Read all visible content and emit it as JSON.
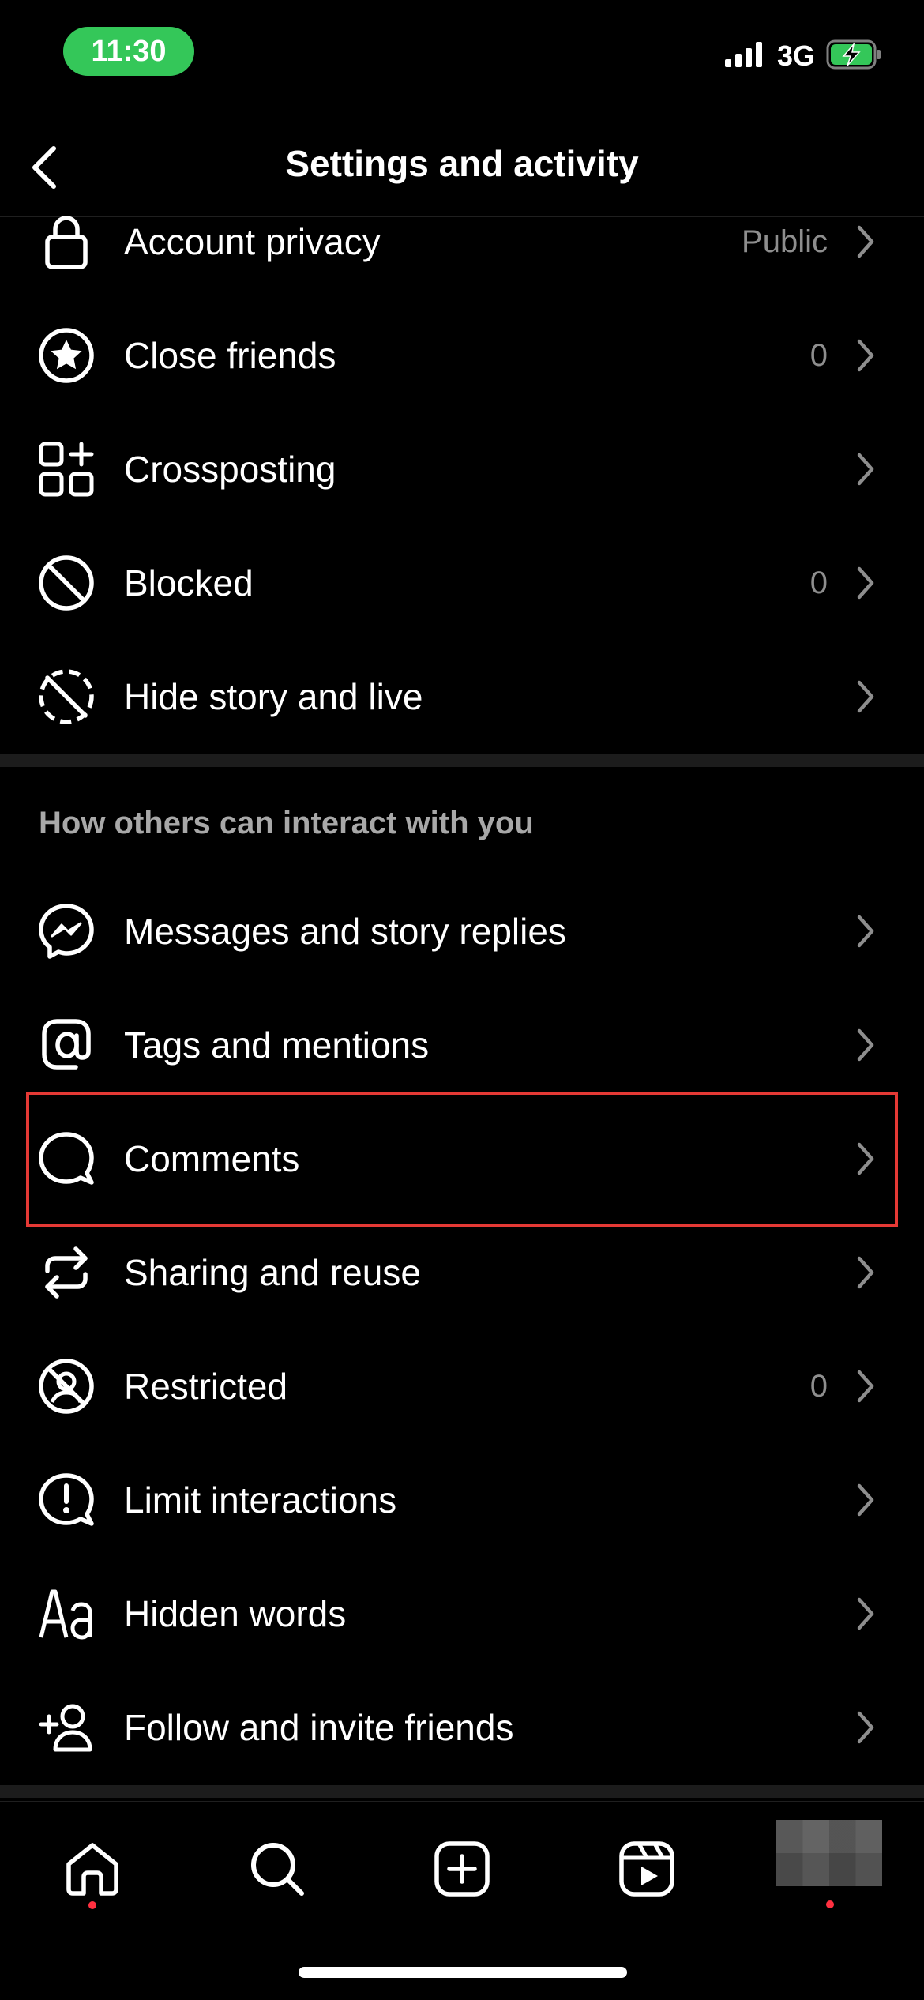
{
  "status_bar": {
    "time": "11:30",
    "network": "3G",
    "battery_icon": "battery-charging-icon",
    "signal_icon": "signal-bars-icon"
  },
  "header": {
    "title": "Settings and activity",
    "back_icon": "chevron-left-icon"
  },
  "privacy_section": {
    "items": [
      {
        "label": "Account privacy",
        "value": "Public",
        "icon": "lock-icon"
      },
      {
        "label": "Close friends",
        "value": "0",
        "icon": "star-circle-icon"
      },
      {
        "label": "Crossposting",
        "value": "",
        "icon": "grid-plus-icon"
      },
      {
        "label": "Blocked",
        "value": "0",
        "icon": "block-icon"
      },
      {
        "label": "Hide story and live",
        "value": "",
        "icon": "hide-story-icon"
      }
    ]
  },
  "interact_section": {
    "title": "How others can interact with you",
    "items": [
      {
        "label": "Messages and story replies",
        "value": "",
        "icon": "messenger-icon"
      },
      {
        "label": "Tags and mentions",
        "value": "",
        "icon": "at-sign-icon"
      },
      {
        "label": "Comments",
        "value": "",
        "icon": "comment-bubble-icon"
      },
      {
        "label": "Sharing and reuse",
        "value": "",
        "icon": "share-cycle-icon"
      },
      {
        "label": "Restricted",
        "value": "0",
        "icon": "restricted-icon"
      },
      {
        "label": "Limit interactions",
        "value": "",
        "icon": "alert-bubble-icon"
      },
      {
        "label": "Hidden words",
        "value": "",
        "icon": "text-aa-icon"
      },
      {
        "label": "Follow and invite friends",
        "value": "",
        "icon": "add-person-icon"
      }
    ]
  },
  "highlight": {
    "color": "#e53935",
    "target": "Comments"
  },
  "bottom_nav": {
    "items": [
      "home-icon",
      "search-icon",
      "create-icon",
      "reels-icon",
      "profile-avatar"
    ],
    "dot_color": "#ff3040"
  },
  "colors": {
    "background": "#000000",
    "text": "#ffffff",
    "muted": "#8e8e8e",
    "status_pill": "#34c759"
  }
}
